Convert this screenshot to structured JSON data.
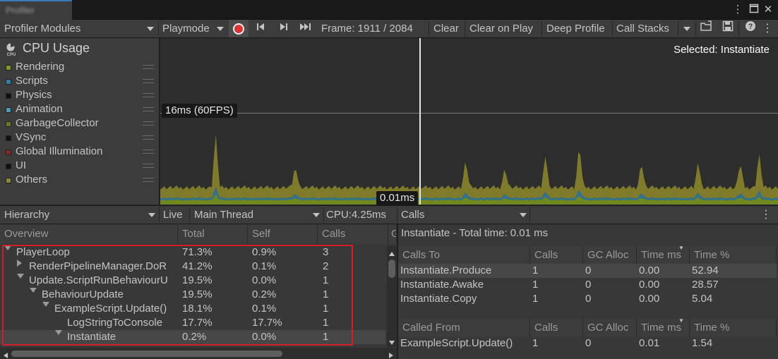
{
  "window": {
    "tab_label": "Profiler"
  },
  "toolbar": {
    "modules_dropdown": "Profiler Modules",
    "playmode_dropdown": "Playmode",
    "frame_label": "Frame: 1911 / 2084",
    "clear": "Clear",
    "clear_on_play": "Clear on Play",
    "deep_profile": "Deep Profile",
    "call_stacks": "Call Stacks"
  },
  "module": {
    "title": "CPU Usage",
    "categories": [
      {
        "label": "Rendering",
        "color": "#7b9a1e"
      },
      {
        "label": "Scripts",
        "color": "#2f7fa8"
      },
      {
        "label": "Physics",
        "color": "#111111"
      },
      {
        "label": "Animation",
        "color": "#4a9cbb"
      },
      {
        "label": "GarbageCollector",
        "color": "#6b7a25"
      },
      {
        "label": "VSync",
        "color": "#111111"
      },
      {
        "label": "Global Illumination",
        "color": "#8a2a1e"
      },
      {
        "label": "UI",
        "color": "#111111"
      },
      {
        "label": "Others",
        "color": "#8e8a2a"
      }
    ]
  },
  "chart_data": {
    "type": "area",
    "selected_label": "Selected: Instantiate",
    "threshold_label": "16ms (60FPS)",
    "threshold_ms": 16,
    "ymax_ms": 29,
    "cursor_frame": 1911,
    "cursor_value_label": "0.01ms",
    "frame_range": [
      1627,
      2084
    ],
    "baseline_ms": {
      "Rendering": 0.7,
      "Scripts": 0.3,
      "Others": 1.6
    },
    "spike_frames": [
      1668,
      1727,
      1853,
      1882,
      1912,
      1937,
      1983,
      2025,
      2056,
      2070
    ],
    "spike_ms": [
      9.4,
      4.1,
      5.0,
      3.6,
      6.0,
      7.9,
      4.6,
      4.5,
      4.6,
      6.1
    ],
    "colors": {
      "Rendering": "#7b9a1e",
      "Scripts": "#2f7fa8",
      "Others": "#8e8a2a"
    }
  },
  "lower_toolbar": {
    "view_dropdown": "Hierarchy",
    "live": "Live",
    "thread_dropdown": "Main Thread",
    "cpu_label": "CPU:4.25ms",
    "calls_dropdown": "Calls"
  },
  "hierarchy": {
    "columns": [
      "Overview",
      "Total",
      "Self",
      "Calls",
      "G"
    ],
    "rows": [
      {
        "name": "PlayerLoop",
        "total": "71.3%",
        "self": "0.9%",
        "calls": "3",
        "expand": "down"
      },
      {
        "name": "RenderPipelineManager.DoR",
        "total": "41.2%",
        "self": "0.1%",
        "calls": "2",
        "expand": "right"
      },
      {
        "name": "Update.ScriptRunBehaviourU",
        "total": "19.5%",
        "self": "0.0%",
        "calls": "1",
        "expand": "down"
      },
      {
        "name": "BehaviourUpdate",
        "total": "19.5%",
        "self": "0.2%",
        "calls": "1",
        "expand": "down"
      },
      {
        "name": "ExampleScript.Update()",
        "total": "18.1%",
        "self": "0.1%",
        "calls": "1",
        "expand": "down"
      },
      {
        "name": "LogStringToConsole",
        "total": "17.7%",
        "self": "17.7%",
        "calls": "1",
        "expand": "none"
      },
      {
        "name": "Instantiate",
        "total": "0.2%",
        "self": "0.0%",
        "calls": "1",
        "expand": "down"
      }
    ]
  },
  "details": {
    "title": "Instantiate - Total time: 0.01 ms",
    "calls_to": {
      "columns": [
        "Calls To",
        "Calls",
        "GC Alloc",
        "Time ms",
        "Time %"
      ],
      "rows": [
        [
          "Instantiate.Produce",
          "1",
          "0",
          "0.00",
          "52.94"
        ],
        [
          "Instantiate.Awake",
          "1",
          "0",
          "0.00",
          "28.57"
        ],
        [
          "Instantiate.Copy",
          "1",
          "0",
          "0.00",
          "5.04"
        ]
      ]
    },
    "called_from": {
      "columns": [
        "Called From",
        "Calls",
        "GC Alloc",
        "Time ms",
        "Time %"
      ],
      "rows": [
        [
          "ExampleScript.Update()",
          "1",
          "0",
          "0.01",
          "1.54"
        ]
      ]
    }
  }
}
